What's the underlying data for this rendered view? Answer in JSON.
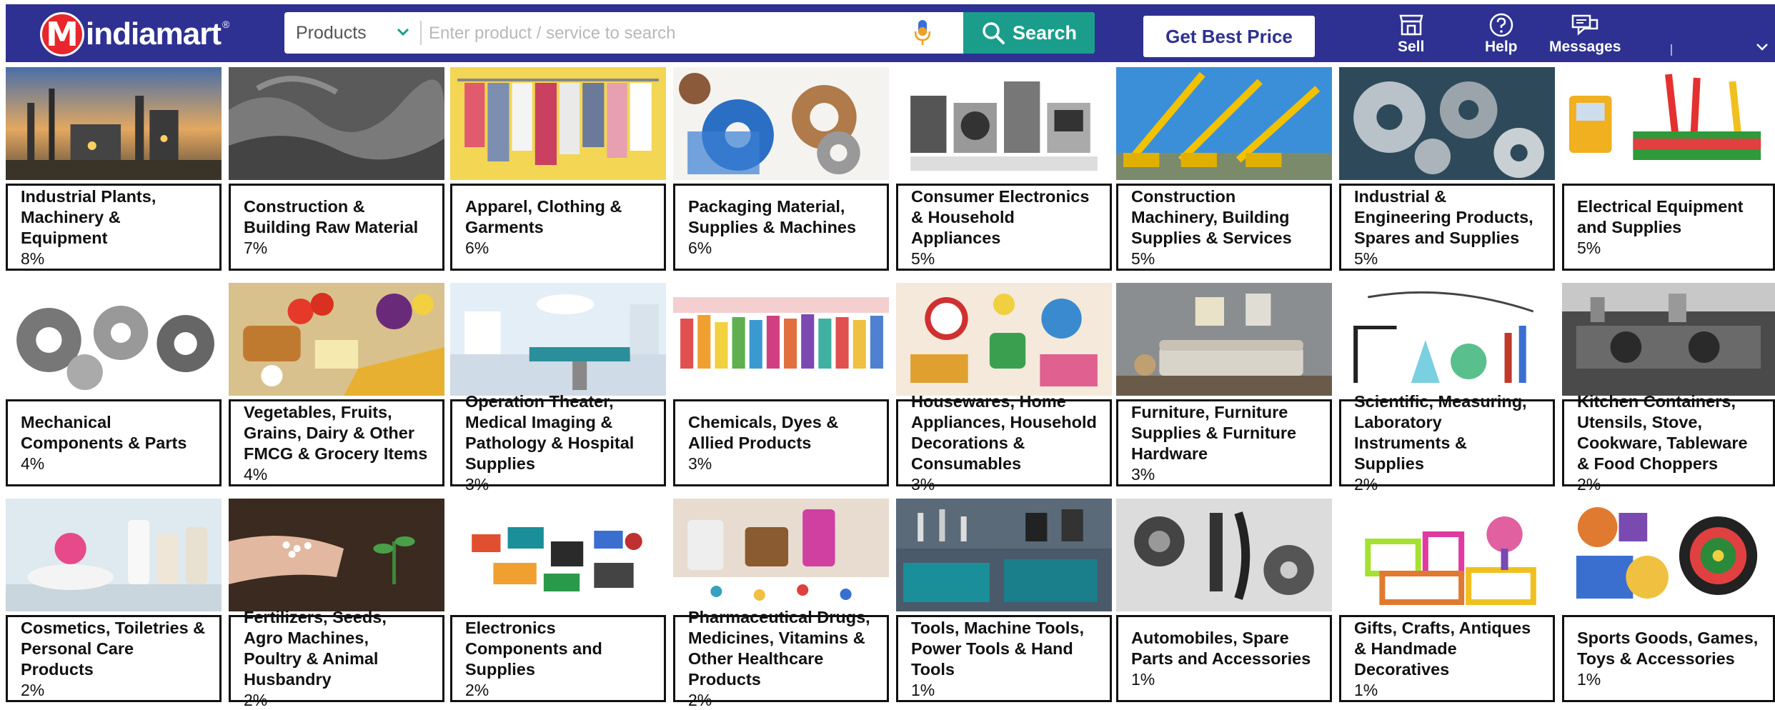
{
  "header": {
    "logo_letter": "M",
    "logo_text": "indiamart",
    "logo_reg": "®",
    "search_category": "Products",
    "search_placeholder": "Enter product / service to search",
    "search_button": "Search",
    "best_price_button": "Get Best Price",
    "sell_label": "Sell",
    "help_label": "Help",
    "messages_label": "Messages",
    "divider": "|"
  },
  "colors": {
    "header_bg": "#2e3192",
    "search_button_bg": "#1a9e8b",
    "logo_red": "#e8262c"
  },
  "categories": [
    {
      "name": "Industrial Plants, Machinery & Equipment",
      "share": "8%",
      "image": "industrial-plant"
    },
    {
      "name": "Construction & Building Raw Material",
      "share": "7%",
      "image": "gravel"
    },
    {
      "name": "Apparel, Clothing & Garments",
      "share": "6%",
      "image": "clothing-rack"
    },
    {
      "name": "Packaging Material, Supplies & Machines",
      "share": "6%",
      "image": "packaging-tapes"
    },
    {
      "name": "Consumer Electronics & Household Appliances",
      "share": "5%",
      "image": "appliances"
    },
    {
      "name": "Construction Machinery, Building Supplies & Services",
      "share": "5%",
      "image": "cranes"
    },
    {
      "name": "Industrial & Engineering Products, Spares and Supplies",
      "share": "5%",
      "image": "gears"
    },
    {
      "name": "Electrical Equipment and Supplies",
      "share": "5%",
      "image": "electrical-tools"
    },
    {
      "name": "Mechanical Components & Parts",
      "share": "4%",
      "image": "bearings"
    },
    {
      "name": "Vegetables, Fruits, Grains, Dairy & Other FMCG & Grocery Items",
      "share": "4%",
      "image": "groceries"
    },
    {
      "name": "Operation Theater, Medical Imaging & Pathology & Hospital Supplies",
      "share": "3%",
      "image": "operation-theater"
    },
    {
      "name": "Chemicals, Dyes & Allied Products",
      "share": "3%",
      "image": "chemical-bottles"
    },
    {
      "name": "Housewares, Home Appliances, Household Decorations & Consumables",
      "share": "3%",
      "image": "housewares"
    },
    {
      "name": "Furniture, Furniture Supplies & Furniture Hardware",
      "share": "3%",
      "image": "living-room"
    },
    {
      "name": "Scientific, Measuring, Laboratory Instruments & Supplies",
      "share": "2%",
      "image": "lab-glassware"
    },
    {
      "name": "Kitchen Containers, Utensils, Stove, Cookware, Tableware & Food Choppers",
      "share": "2%",
      "image": "kitchen"
    },
    {
      "name": "Cosmetics, Toiletries & Personal Care Products",
      "share": "2%",
      "image": "cosmetics"
    },
    {
      "name": "Fertilizers, Seeds, Agro Machines, Poultry & Animal Husbandry",
      "share": "2%",
      "image": "fertilizer-hand"
    },
    {
      "name": "Electronics Components and Supplies",
      "share": "2%",
      "image": "electronic-parts"
    },
    {
      "name": "Pharmaceutical Drugs, Medicines, Vitamins & Other Healthcare Products",
      "share": "2%",
      "image": "pills"
    },
    {
      "name": "Tools, Machine Tools, Power Tools & Hand Tools",
      "share": "1%",
      "image": "power-tools"
    },
    {
      "name": "Automobiles, Spare Parts and Accessories",
      "share": "1%",
      "image": "auto-parts"
    },
    {
      "name": "Gifts, Crafts, Antiques & Handmade Decoratives",
      "share": "1%",
      "image": "gift-shelves"
    },
    {
      "name": "Sports Goods, Games, Toys & Accessories",
      "share": "1%",
      "image": "sports-goods"
    }
  ]
}
